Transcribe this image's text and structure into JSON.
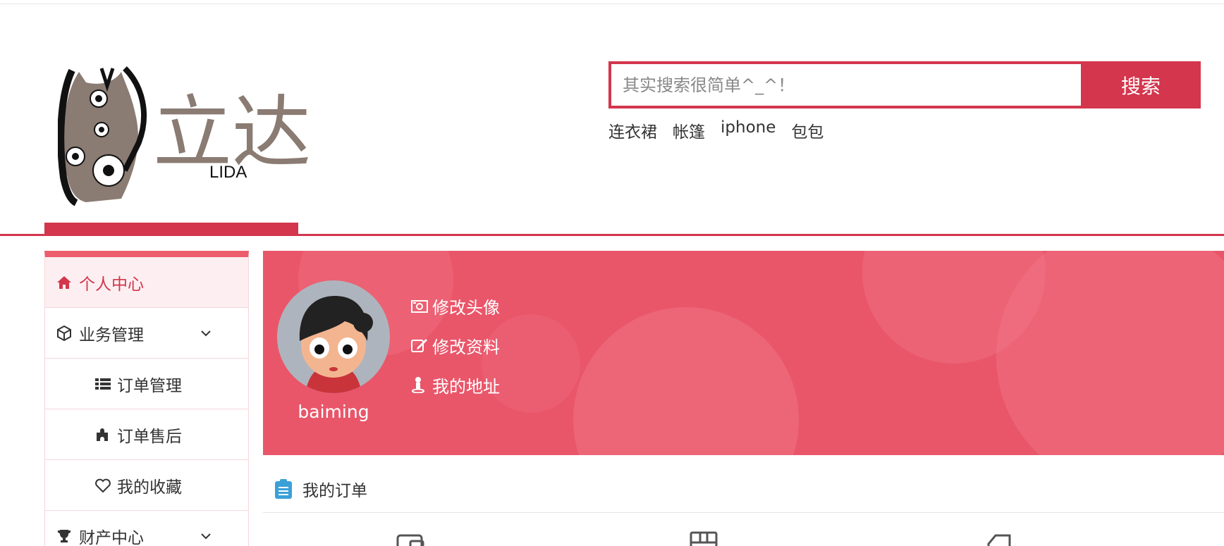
{
  "logo": {
    "text": "立达",
    "subtext": "LIDA"
  },
  "search": {
    "placeholder": "其实搜索很简单^_^！",
    "button_label": "搜索"
  },
  "hot_words": [
    "连衣裙",
    "帐篷",
    "iphone",
    "包包"
  ],
  "sidebar": {
    "items": [
      {
        "label": "个人中心",
        "icon": "home-icon",
        "active": true
      },
      {
        "label": "业务管理",
        "icon": "cube-icon",
        "expandable": true
      },
      {
        "label": "订单管理",
        "icon": "list-icon",
        "sub": true
      },
      {
        "label": "订单售后",
        "icon": "puzzle-icon",
        "sub": true
      },
      {
        "label": "我的收藏",
        "icon": "heart-icon",
        "sub": true
      },
      {
        "label": "财产中心",
        "icon": "trophy-icon",
        "expandable": true
      }
    ]
  },
  "profile": {
    "username": "baiming",
    "links": [
      {
        "label": "修改头像",
        "icon": "camera-icon"
      },
      {
        "label": "修改资料",
        "icon": "edit-icon"
      },
      {
        "label": "我的地址",
        "icon": "location-pin-icon"
      }
    ]
  },
  "orders": {
    "title": "我的订单",
    "icon": "clipboard-icon"
  },
  "colors": {
    "accent": "#d3364d",
    "banner": "#e9566a",
    "sidebar_active_bg": "#fdeff1"
  }
}
